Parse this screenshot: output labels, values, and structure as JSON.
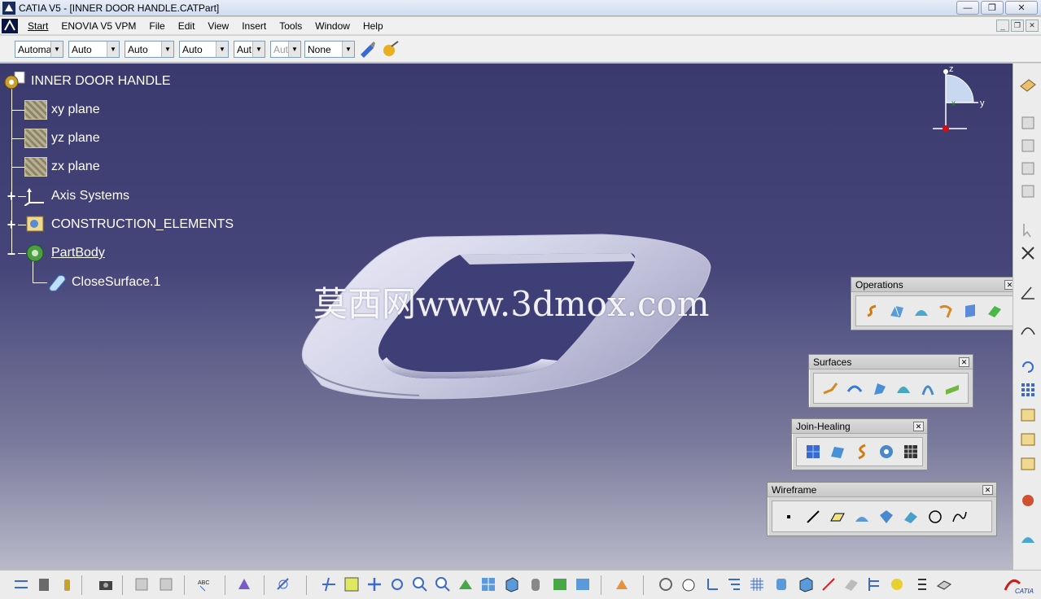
{
  "window": {
    "title": "CATIA V5 - [INNER DOOR HANDLE.CATPart]"
  },
  "menu": [
    {
      "label": "Start"
    },
    {
      "label": "ENOVIA V5 VPM"
    },
    {
      "label": "File"
    },
    {
      "label": "Edit"
    },
    {
      "label": "View"
    },
    {
      "label": "Insert"
    },
    {
      "label": "Tools"
    },
    {
      "label": "Window"
    },
    {
      "label": "Help"
    }
  ],
  "properties_toolbar": {
    "combos": [
      "Automa",
      "Auto",
      "Auto",
      "Auto",
      "Aut",
      "Aut",
      "None"
    ],
    "disabled_index": 5,
    "icons": [
      "painter-icon",
      "apply-material-icon"
    ]
  },
  "spec_tree": {
    "root": "INNER DOOR HANDLE",
    "nodes": [
      {
        "label": "xy plane",
        "icon": "plane-icon"
      },
      {
        "label": "yz plane",
        "icon": "plane-icon"
      },
      {
        "label": "zx plane",
        "icon": "plane-icon"
      },
      {
        "label": "Axis Systems",
        "icon": "axis-system-icon"
      },
      {
        "label": "CONSTRUCTION_ELEMENTS",
        "icon": "geometrical-set-icon"
      },
      {
        "label": "PartBody",
        "icon": "part-body-icon"
      },
      {
        "label": "CloseSurface.1",
        "icon": "close-surface-icon"
      }
    ]
  },
  "compass": {
    "labels": [
      "z",
      "x",
      "y"
    ]
  },
  "watermark": "莫西网www.3dmox.com",
  "floating_toolbars": {
    "operations": {
      "title": "Operations"
    },
    "surfaces": {
      "title": "Surfaces"
    },
    "join_healing": {
      "title": "Join-Healing"
    },
    "wireframe": {
      "title": "Wireframe"
    }
  },
  "colors": {
    "viewport_top": "#3a3a6e",
    "viewport_bottom": "#b9b9c9",
    "model": "#e2e2f2"
  }
}
